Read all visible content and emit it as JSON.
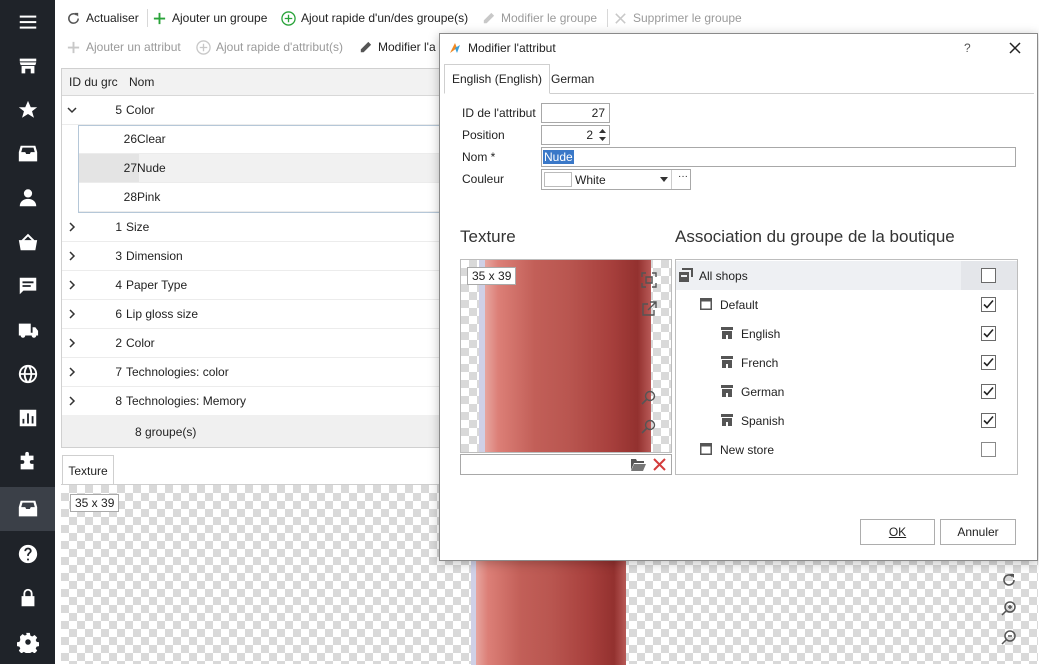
{
  "toolbar1": {
    "refresh": "Actualiser",
    "add_group": "Ajouter un groupe",
    "quick_add_group": "Ajout rapide d'un/des groupe(s)",
    "edit_group": "Modifier le groupe",
    "delete_group": "Supprimer le groupe"
  },
  "toolbar2": {
    "add_attr": "Ajouter un attribut",
    "quick_add_attr": "Ajout rapide d'attribut(s)",
    "edit_attr": "Modifier l'a"
  },
  "grid": {
    "col_id": "ID du grc",
    "col_name": "Nom",
    "footer": "8 groupe(s)",
    "rows": [
      {
        "id": "5",
        "name": "Color",
        "expanded": true
      },
      {
        "id": "26",
        "name": "Clear",
        "child": true
      },
      {
        "id": "27",
        "name": "Nude",
        "child": true,
        "selected": true
      },
      {
        "id": "28",
        "name": "Pink",
        "child": true
      },
      {
        "id": "1",
        "name": "Size"
      },
      {
        "id": "3",
        "name": "Dimension"
      },
      {
        "id": "4",
        "name": "Paper Type"
      },
      {
        "id": "6",
        "name": "Lip gloss size"
      },
      {
        "id": "2",
        "name": "Color"
      },
      {
        "id": "7",
        "name": "Technologies:  color"
      },
      {
        "id": "8",
        "name": "Technologies: Memory"
      }
    ]
  },
  "bottom": {
    "tab": "Texture",
    "dims": "35 x 39"
  },
  "dialog": {
    "title": "Modifier l'attribut",
    "help": "?",
    "tabs": [
      "English (English)",
      "German"
    ],
    "labels": {
      "id": "ID de l'attribut",
      "position": "Position",
      "name": "Nom *",
      "color": "Couleur"
    },
    "values": {
      "id": "27",
      "position": "2",
      "name": "Nude",
      "color": "White",
      "color_hex": "#ffffff"
    },
    "texture_title": "Texture",
    "texture_dims": "35 x 39",
    "assoc_title": "Association du groupe de la boutique",
    "shops": [
      {
        "label": "All shops",
        "level": 0,
        "checked": false,
        "icon": "shop-group-icon"
      },
      {
        "label": "Default",
        "level": 1,
        "checked": true,
        "icon": "window-icon"
      },
      {
        "label": "English",
        "level": 2,
        "checked": true,
        "icon": "store-icon"
      },
      {
        "label": "French",
        "level": 2,
        "checked": true,
        "icon": "store-icon"
      },
      {
        "label": "German",
        "level": 2,
        "checked": true,
        "icon": "store-icon"
      },
      {
        "label": "Spanish",
        "level": 2,
        "checked": true,
        "icon": "store-icon"
      },
      {
        "label": "New store",
        "level": 1,
        "checked": false,
        "icon": "window-icon"
      }
    ],
    "ok": "OK",
    "cancel": "Annuler"
  },
  "colors": {
    "sidebar": "#1f2329",
    "accent_green": "#2aa33a",
    "delete_red": "#d43b3b",
    "selection": "#3a78c8"
  }
}
